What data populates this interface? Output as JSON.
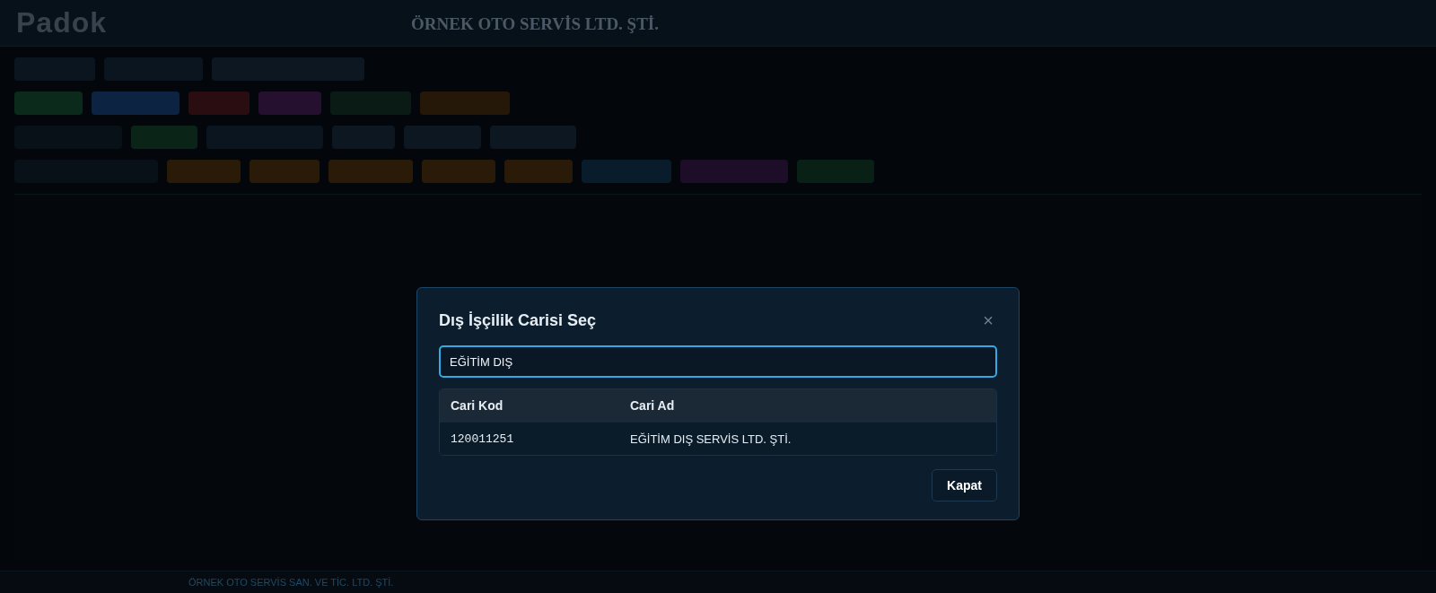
{
  "header": {
    "logo": "Padok",
    "company": "ÖRNEK OTO SERVİS LTD. ŞTİ."
  },
  "dialog": {
    "title": "Dış İşçilik Carisi Seç",
    "close": "×",
    "search": {
      "value": "EĞİTİM DIŞ"
    },
    "table": {
      "columns": [
        "Cari Kod",
        "Cari Ad"
      ],
      "rows": [
        [
          "120011251",
          "EĞİTİM DIŞ SERVİS LTD. ŞTİ."
        ]
      ]
    },
    "buttons": [
      "Kapat"
    ]
  },
  "status_bar": {
    "company": "ÖRNEK OTO SERVİS SAN. VE TİC. LTD. ŞTİ."
  }
}
